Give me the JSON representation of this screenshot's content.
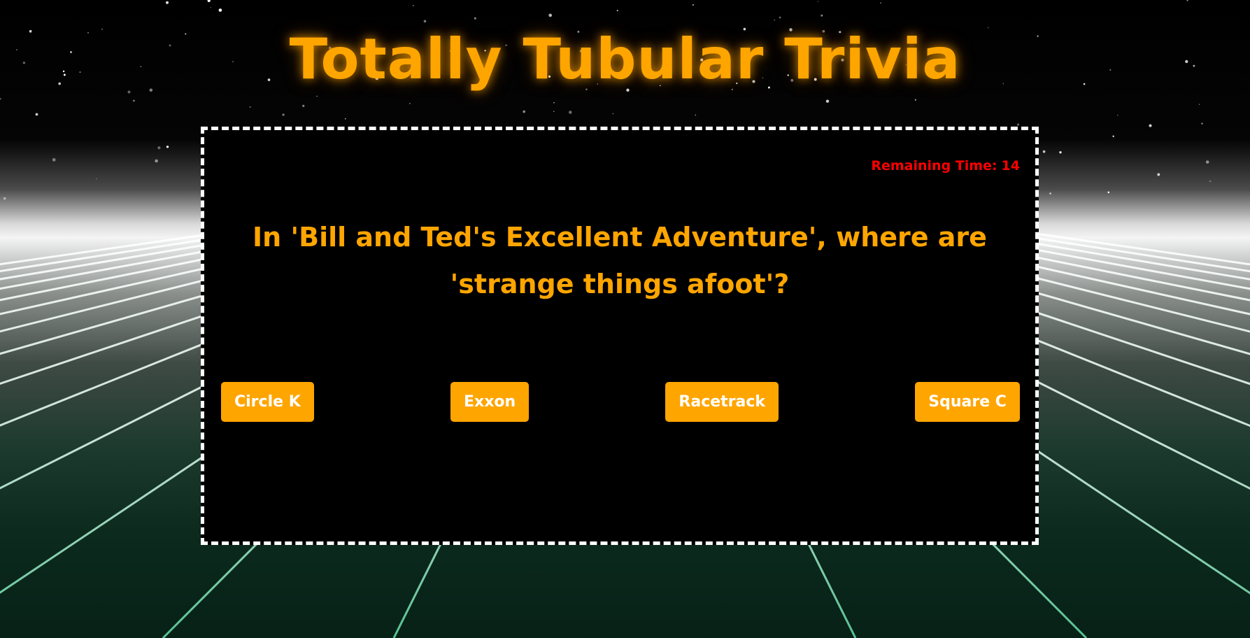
{
  "page": {
    "title": "Totally Tubular Trivia"
  },
  "game": {
    "timer_label": "Remaining Time:",
    "timer_value": "14",
    "question": "In 'Bill and Ted's Excellent Adventure', where are 'strange things afoot'?",
    "answers": [
      "Circle K",
      "Exxon",
      "Racetrack",
      "Square C"
    ]
  },
  "colors": {
    "accent": "#ffa500",
    "timer": "#ff0000",
    "panel_background": "#000000",
    "panel_border": "#ffffff",
    "button_text": "#ffffff"
  },
  "background": {
    "theme": "retro-synthwave-grid-starfield"
  }
}
